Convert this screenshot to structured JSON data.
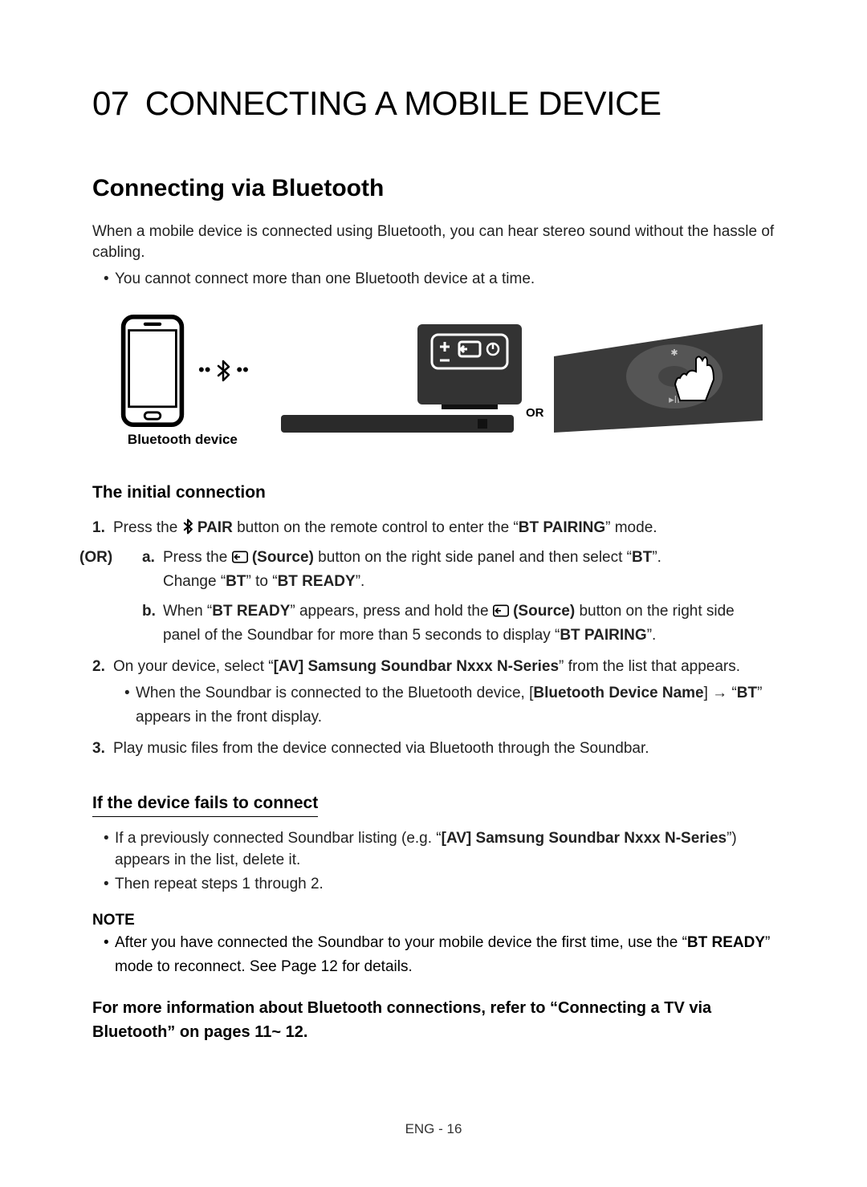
{
  "chapter": {
    "num": "07",
    "title": "CONNECTING A MOBILE DEVICE"
  },
  "section1": {
    "heading": "Connecting via Bluetooth",
    "intro": "When a mobile device is connected using Bluetooth, you can hear stereo sound without the hassle of cabling.",
    "bullet1": "You cannot connect more than one Bluetooth device at a time."
  },
  "figure": {
    "bt_caption": "Bluetooth device",
    "or_label": "OR"
  },
  "initial": {
    "heading": "The initial connection",
    "or_label": "(OR)",
    "step1_prefix": "Press the ",
    "step1_pair": " PAIR",
    "step1_mid": " button on the remote control to enter the “",
    "step1_btpairing": "BT PAIRING",
    "step1_suffix": "” mode.",
    "sub_a_prefix": "Press the ",
    "sub_a_source": " (Source)",
    "sub_a_mid": " button on the right side panel and then select “",
    "sub_a_bt": "BT",
    "sub_a_suffix": "”.",
    "sub_a_line2_prefix": "Change “",
    "sub_a_line2_bt": "BT",
    "sub_a_line2_mid": "” to “",
    "sub_a_line2_btready": "BT READY",
    "sub_a_line2_suffix": "”.",
    "sub_b_prefix": "When “",
    "sub_b_btready": "BT READY",
    "sub_b_mid1": "” appears, press and hold the ",
    "sub_b_source": " (Source)",
    "sub_b_mid2": " button on the right side panel of the Soundbar for more than 5 seconds to display “",
    "sub_b_btpairing": "BT PAIRING",
    "sub_b_suffix": "”.",
    "step2_prefix": "On your device, select “",
    "step2_av": "[AV] Samsung Soundbar Nxxx N-Series",
    "step2_suffix": "” from the list that appears.",
    "step2_sub_prefix": "When the Soundbar is connected to the Bluetooth device, [",
    "step2_sub_bdn": "Bluetooth Device Name",
    "step2_sub_mid": "] → “",
    "step2_sub_bt": "BT",
    "step2_sub_suffix": "” appears in the front display.",
    "step3": "Play music files from the device connected via Bluetooth through the Soundbar."
  },
  "fails": {
    "heading": "If the device fails to connect",
    "b1_prefix": "If a previously connected Soundbar listing (e.g. “",
    "b1_av": "[AV] Samsung Soundbar Nxxx N-Series",
    "b1_suffix": "”) appears in the list, delete it.",
    "b2": "Then repeat steps 1 through 2."
  },
  "note": {
    "label": "NOTE",
    "text_prefix": "After you have connected the Soundbar to your mobile device the first time, use the “",
    "text_btready": "BT READY",
    "text_suffix": "” mode to reconnect. See Page 12 for details."
  },
  "more_info": "For more information about Bluetooth connections, refer to “Connecting a TV via Bluetooth” on pages 11~ 12.",
  "footer": "ENG - 16"
}
